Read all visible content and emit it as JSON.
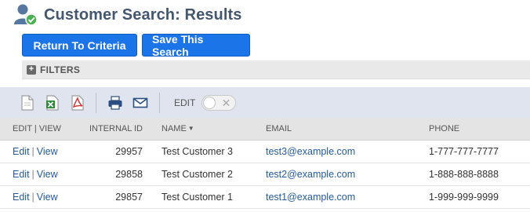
{
  "page": {
    "title": "Customer Search: Results"
  },
  "buttons": {
    "return_label": "Return To Criteria",
    "save_label": "Save This Search"
  },
  "filters": {
    "label": "FILTERS",
    "toggle_symbol": "+"
  },
  "toolbar": {
    "icons": [
      "new-document-icon",
      "export-excel-icon",
      "export-pdf-icon",
      "print-icon",
      "email-icon"
    ],
    "edit_label": "EDIT",
    "edit_toggle_on": false
  },
  "table": {
    "columns": {
      "edit_view": "EDIT | VIEW",
      "internal_id": "INTERNAL ID",
      "name": "NAME",
      "email": "EMAIL",
      "phone": "PHONE"
    },
    "sort_indicator": "▼",
    "edit_link": "Edit",
    "view_link": "View",
    "rows": [
      {
        "internal_id": "29957",
        "name": "Test Customer 3",
        "email": "test3@example.com",
        "phone": "1-777-777-7777"
      },
      {
        "internal_id": "29858",
        "name": "Test Customer 2",
        "email": "test2@example.com",
        "phone": "1-888-888-8888"
      },
      {
        "internal_id": "29857",
        "name": "Test Customer 1",
        "email": "test1@example.com",
        "phone": "1-999-999-9999"
      }
    ]
  },
  "colors": {
    "primary_button": "#1b74e8",
    "title": "#44576f",
    "link": "#255a9e",
    "toolbar_bg": "#dfe4ee",
    "success_badge": "#4caf50"
  }
}
